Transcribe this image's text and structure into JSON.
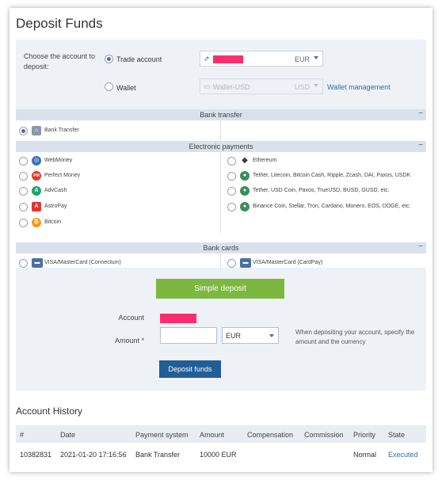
{
  "page": {
    "title": "Deposit Funds"
  },
  "account_select": {
    "prompt": "Choose the account to deposit:",
    "options": [
      {
        "label": "Trade account",
        "selected": true,
        "currency": "EUR"
      },
      {
        "label": "Wallet",
        "selected": false,
        "value": "Wallet-USD",
        "currency": "USD"
      }
    ],
    "wallet_link": "Wallet management"
  },
  "sections": {
    "bank_transfer": {
      "title": "Bank transfer",
      "items": [
        {
          "label": "Bank Transfer",
          "icon": "bank-transfer-icon",
          "selected": true
        }
      ]
    },
    "electronic": {
      "title": "Electronic payments",
      "left": [
        {
          "label": "WebMoney",
          "icon": "webmoney-icon"
        },
        {
          "label": "Perfect Money",
          "icon": "perfect-money-icon",
          "glyph": "PM"
        },
        {
          "label": "AdvCash",
          "icon": "advcash-icon",
          "glyph": "A"
        },
        {
          "label": "AstroPay",
          "icon": "astropay-icon",
          "glyph": "A"
        },
        {
          "label": "Bitcoin",
          "icon": "bitcoin-icon",
          "glyph": "₿"
        }
      ],
      "right": [
        {
          "label": "Ethereum",
          "icon": "ethereum-icon"
        },
        {
          "label": "Tether, Litecoin, Bitcoin Cash, Ripple, Zcash, DAI, Paxos, USDK",
          "icon": "crypto-multi-icon"
        },
        {
          "label": "Tether, USD Coin, Paxos, TrueUSD, BUSD, GUSD, etc.",
          "icon": "stablecoin-icon"
        },
        {
          "label": "Binance Coin, Stellar, Tron, Cardano, Monero, EOS, DOGE, etc.",
          "icon": "altcoin-icon"
        }
      ]
    },
    "bank_cards": {
      "title": "Bank cards",
      "items": [
        {
          "label": "VISA/MasterCard (Connectum)",
          "icon": "card-icon"
        },
        {
          "label": "VISA/MasterCard (CardPay)",
          "icon": "card-icon"
        }
      ]
    },
    "collapse_glyph": "−"
  },
  "deposit": {
    "simple_button": "Simple deposit",
    "account_label": "Account",
    "amount_label": "Amount *",
    "currency": "EUR",
    "hint": "When depositing your account, specify the amount and the currency",
    "submit_button": "Deposit funds"
  },
  "history": {
    "title": "Account History",
    "columns": [
      "#",
      "Date",
      "Payment system",
      "Amount",
      "Compensation",
      "Commission",
      "Priority",
      "State"
    ],
    "rows": [
      {
        "id": "10382831",
        "date": "2021-01-20 17:16:56",
        "payment_system": "Bank Transfer",
        "amount": "10000 EUR",
        "compensation": "",
        "commission": "",
        "priority": "Normal",
        "state": "Executed"
      }
    ]
  },
  "colors": {
    "accent_green": "#7cb83f",
    "accent_blue": "#235d96",
    "link": "#2f6db3",
    "redacted": "#ff2d6e"
  }
}
